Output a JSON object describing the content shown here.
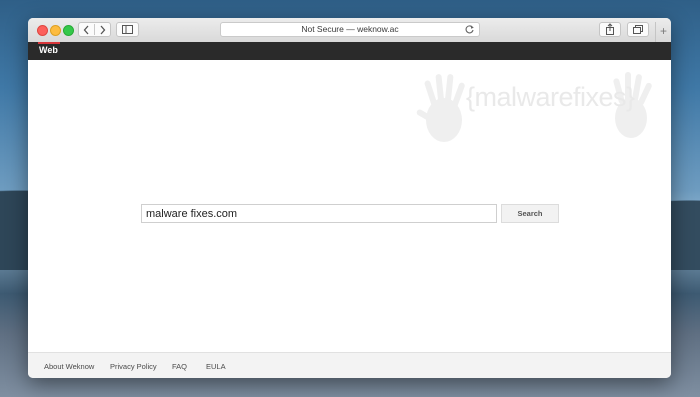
{
  "browser": {
    "address_text": "Not Secure — weknow.ac",
    "new_tab_symbol": "+",
    "icons": {
      "back": "chevron-left-icon",
      "forward": "chevron-right-icon",
      "sidebar": "sidebar-icon",
      "reload": "reload-icon",
      "share": "share-icon",
      "tabs": "tabs-overview-icon"
    }
  },
  "site": {
    "nav_label": "Web",
    "accent_color": "#d8363a",
    "watermark_text": "{malwarefixes}"
  },
  "search": {
    "query": "malware fixes.com",
    "button_label": "Search"
  },
  "footer": {
    "links": [
      "About Weknow",
      "Privacy Policy",
      "FAQ",
      "EULA"
    ]
  }
}
